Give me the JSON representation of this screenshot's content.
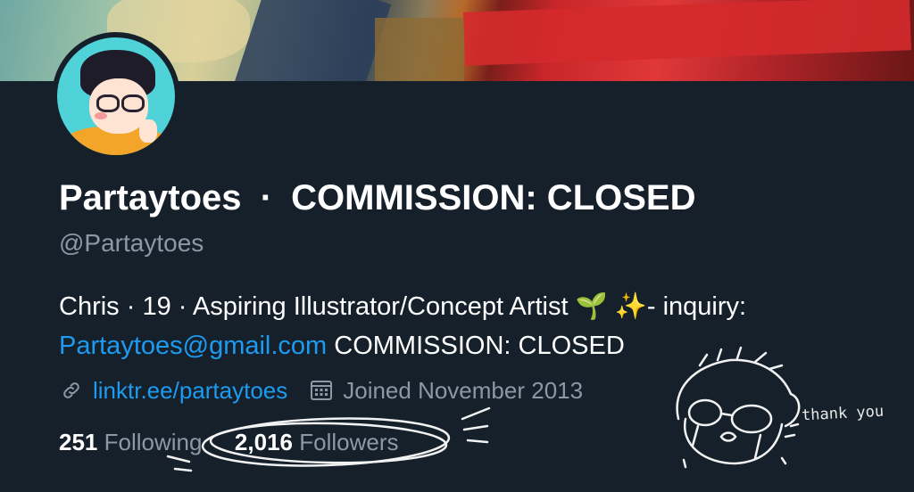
{
  "banner": {
    "image": "banner-artwork"
  },
  "avatar": {
    "image": "cartoon-avatar-boy-with-glasses"
  },
  "profile": {
    "display_name": "Partaytoes",
    "separator": "·",
    "name_suffix": "COMMISSION: CLOSED",
    "handle": "@Partaytoes",
    "bio_line1": "Chris · 19 · Aspiring Illustrator/Concept Artist 🌱 ✨- inquiry:",
    "bio_email": "Partaytoes@gmail.com",
    "bio_line2_rest": " COMMISSION: CLOSED",
    "website": "linktr.ee/partaytoes",
    "joined": "Joined November 2013"
  },
  "stats": {
    "following_count": "251",
    "following_label": "Following",
    "followers_count": "2,016",
    "followers_label": "Followers"
  },
  "doodle": {
    "text": "thank you"
  },
  "colors": {
    "background": "#15202b",
    "secondary_text": "#8b98a5",
    "link": "#1d9bf0"
  },
  "icons": [
    "link-icon",
    "calendar-icon"
  ]
}
